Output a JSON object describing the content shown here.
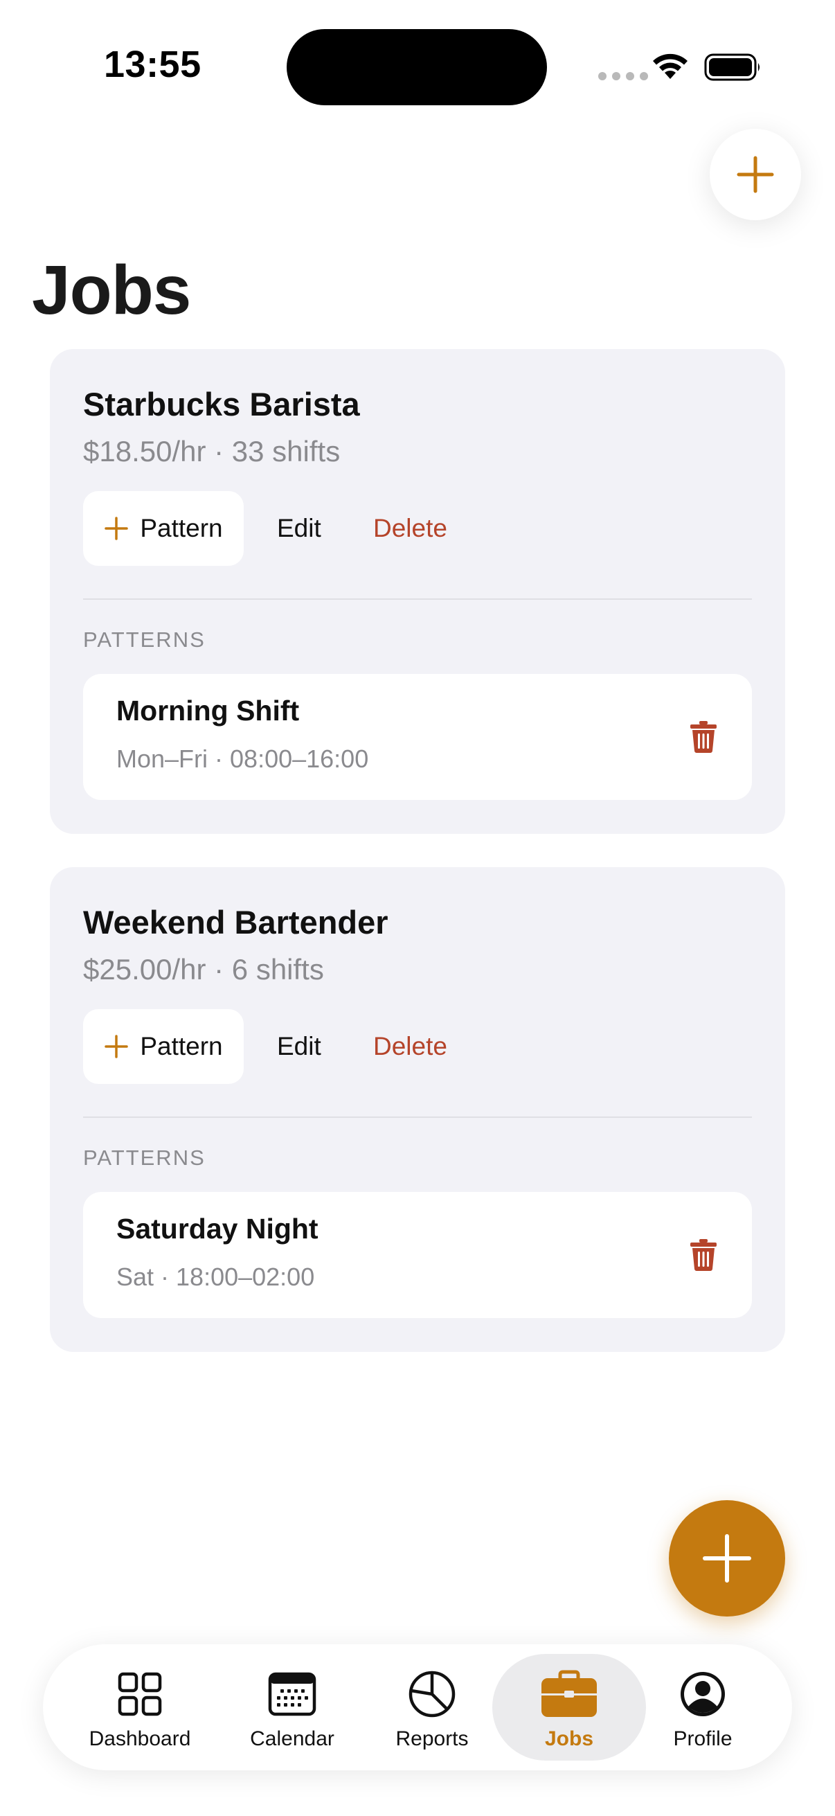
{
  "status_bar": {
    "time": "13:55"
  },
  "page": {
    "title": "Jobs"
  },
  "jobs": [
    {
      "title": "Starbucks Barista",
      "meta": "$18.50/hr · 33 shifts",
      "pattern_button": "Pattern",
      "edit_button": "Edit",
      "delete_button": "Delete",
      "patterns_header": "PATTERNS",
      "patterns": [
        {
          "name": "Morning Shift",
          "detail": "Mon–Fri · 08:00–16:00"
        }
      ]
    },
    {
      "title": "Weekend Bartender",
      "meta": "$25.00/hr · 6 shifts",
      "pattern_button": "Pattern",
      "edit_button": "Edit",
      "delete_button": "Delete",
      "patterns_header": "PATTERNS",
      "patterns": [
        {
          "name": "Saturday Night",
          "detail": "Sat · 18:00–02:00"
        }
      ]
    }
  ],
  "tabbar": {
    "items": [
      {
        "label": "Dashboard",
        "icon": "grid-icon"
      },
      {
        "label": "Calendar",
        "icon": "calendar-icon"
      },
      {
        "label": "Reports",
        "icon": "pie-chart-icon"
      },
      {
        "label": "Jobs",
        "icon": "briefcase-icon"
      },
      {
        "label": "Profile",
        "icon": "person-circle-icon"
      }
    ],
    "active": "Jobs"
  },
  "colors": {
    "accent": "#c47a10",
    "danger": "#b5442a",
    "card_background": "#f2f2f7",
    "secondary_text": "#8a8a8e"
  }
}
